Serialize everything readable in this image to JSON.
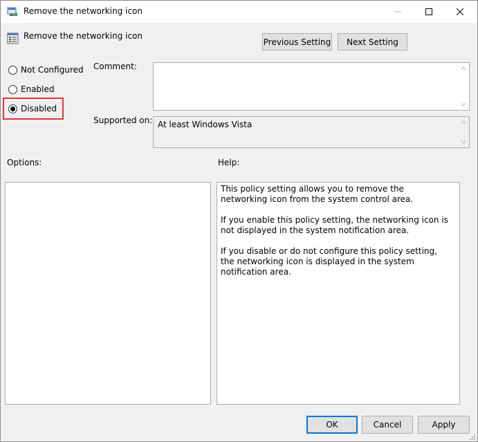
{
  "window": {
    "title": "Remove the networking icon"
  },
  "header": {
    "title": "Remove the networking icon",
    "prev_label": "Previous Setting",
    "next_label": "Next Setting"
  },
  "state": {
    "options": [
      {
        "label": "Not Configured",
        "checked": false
      },
      {
        "label": "Enabled",
        "checked": false
      },
      {
        "label": "Disabled",
        "checked": true
      }
    ]
  },
  "comment": {
    "label": "Comment:",
    "value": ""
  },
  "supported": {
    "label": "Supported on:",
    "value": "At least Windows Vista"
  },
  "options_panel": {
    "label": "Options:"
  },
  "help": {
    "label": "Help:",
    "paragraphs": [
      "This policy setting allows you to remove the networking icon from the system control area.",
      "If you enable this policy setting, the networking icon is not displayed in the system notification area.",
      "If you disable or do not configure this policy setting, the networking icon is displayed in the system notification area."
    ]
  },
  "footer": {
    "ok_label": "OK",
    "cancel_label": "Cancel",
    "apply_label": "Apply"
  },
  "colors": {
    "highlight": "#e8313a",
    "accent": "#0078d7"
  }
}
